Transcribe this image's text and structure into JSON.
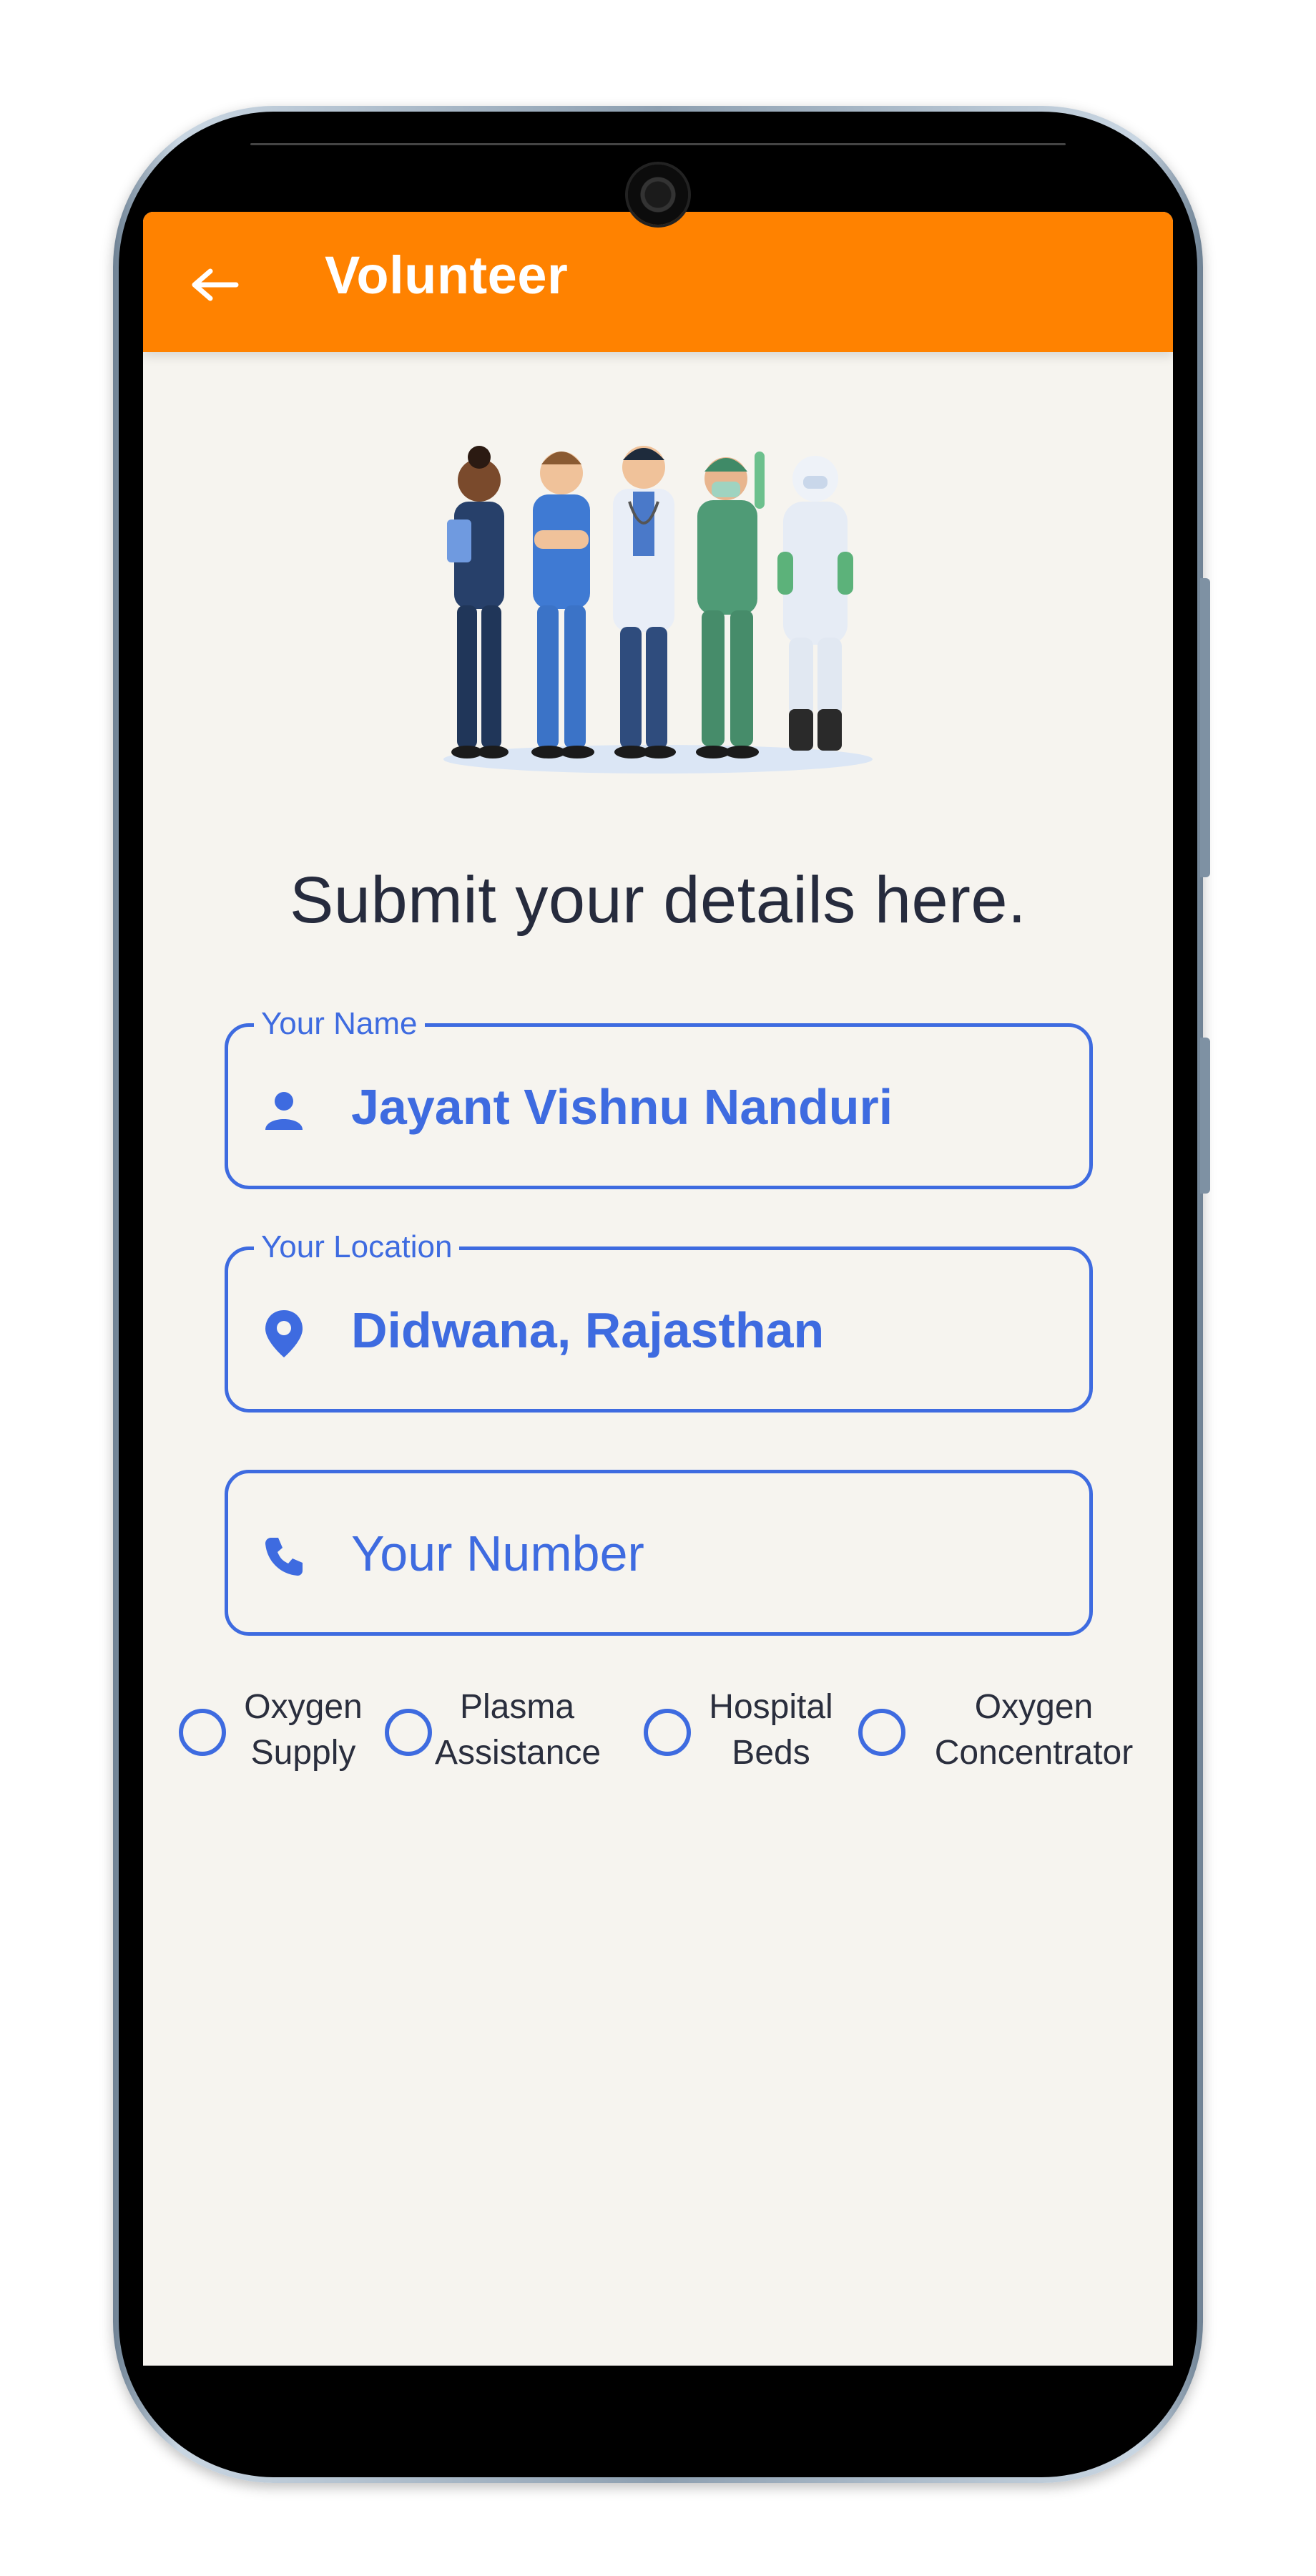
{
  "appbar": {
    "back_icon": "arrow-left-icon",
    "title": "Volunteer",
    "color": "#ff8200"
  },
  "illustration": {
    "description": "medical-staff-group"
  },
  "form": {
    "heading": "Submit your details here.",
    "accent_color": "#3e6be0",
    "name_field": {
      "label": "Your Name",
      "icon": "person-icon",
      "value": "Jayant Vishnu Nanduri"
    },
    "location_field": {
      "label": "Your Location",
      "icon": "location-pin-icon",
      "value": "Didwana, Rajasthan"
    },
    "number_field": {
      "icon": "phone-icon",
      "placeholder": "Your Number",
      "value": ""
    },
    "options": [
      {
        "line1": "Oxygen",
        "line2": "Supply",
        "selected": false
      },
      {
        "line1": "Plasma",
        "line2": "Assistance",
        "selected": false
      },
      {
        "line1": "Hospital",
        "line2": "Beds",
        "selected": false
      },
      {
        "line1": "Oxygen",
        "line2": "Concentrator",
        "selected": false
      }
    ]
  }
}
